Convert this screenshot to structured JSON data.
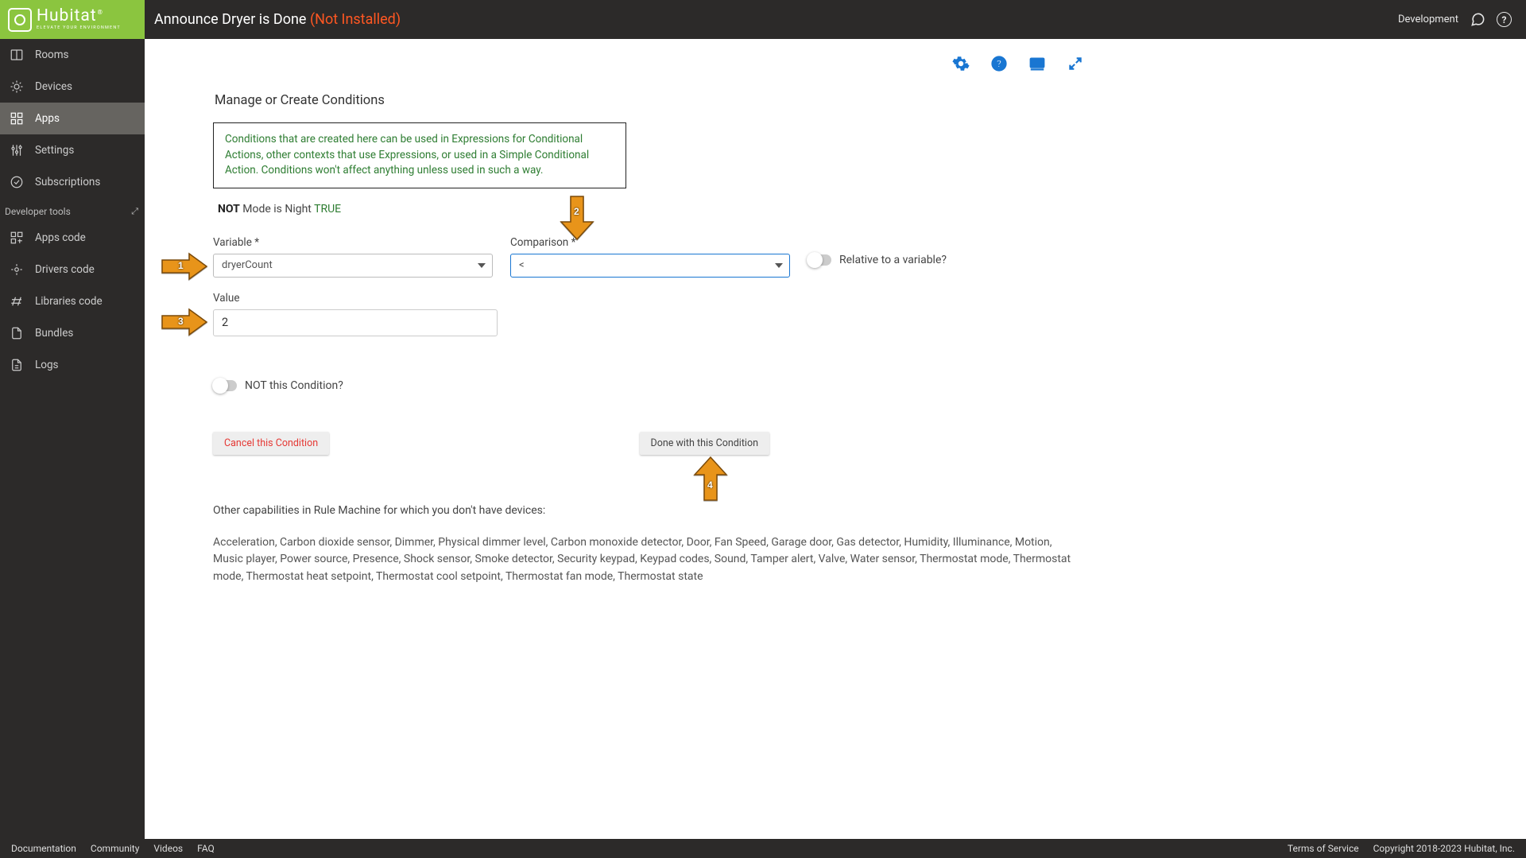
{
  "brand": {
    "name": "Hubitat",
    "tagline": "ELEVATE YOUR ENVIRONMENT"
  },
  "header": {
    "title": "Announce Dryer is Done ",
    "status": "(Not Installed)",
    "env": "Development"
  },
  "sidebar": {
    "items": [
      {
        "label": "Rooms"
      },
      {
        "label": "Devices"
      },
      {
        "label": "Apps"
      },
      {
        "label": "Settings"
      },
      {
        "label": "Subscriptions"
      }
    ],
    "dev_header": "Developer tools",
    "dev_items": [
      {
        "label": "Apps code"
      },
      {
        "label": "Drivers code"
      },
      {
        "label": "Libraries code"
      },
      {
        "label": "Bundles"
      },
      {
        "label": "Logs"
      }
    ]
  },
  "page": {
    "section_title": "Manage or Create Conditions",
    "info": "Conditions that are created here can be used in Expressions for Conditional Actions, other contexts that use Expressions, or used in a Simple Conditional Action.  Conditions won't affect anything unless used in such a way.",
    "existing": {
      "not": "NOT",
      "text": " Mode is Night ",
      "truth": "TRUE"
    },
    "variable_label": "Variable *",
    "variable_value": "dryerCount",
    "comparison_label": "Comparison *",
    "comparison_value": "<",
    "relative_label": "Relative to a variable?",
    "value_label": "Value",
    "value_value": "2",
    "not_cond_label": "NOT this Condition?",
    "cancel_btn": "Cancel this Condition",
    "done_btn": "Done with this Condition",
    "other_heading": "Other capabilities in Rule Machine for which you don't have devices:",
    "other_list": "Acceleration, Carbon dioxide sensor, Dimmer, Physical dimmer level, Carbon monoxide detector, Door, Fan Speed, Garage door, Gas detector, Humidity, Illuminance, Motion, Music player, Power source, Presence, Shock sensor, Smoke detector, Security keypad, Keypad codes, Sound, Tamper alert, Valve, Water sensor, Thermostat mode, Thermostat mode, Thermostat heat setpoint, Thermostat cool setpoint, Thermostat fan mode, Thermostat state"
  },
  "footer": {
    "links": [
      "Documentation",
      "Community",
      "Videos",
      "FAQ"
    ],
    "tos": "Terms of Service",
    "copyright": "Copyright 2018-2023 Hubitat, Inc."
  },
  "arrows": {
    "n1": "1",
    "n2": "2",
    "n3": "3",
    "n4": "4"
  }
}
